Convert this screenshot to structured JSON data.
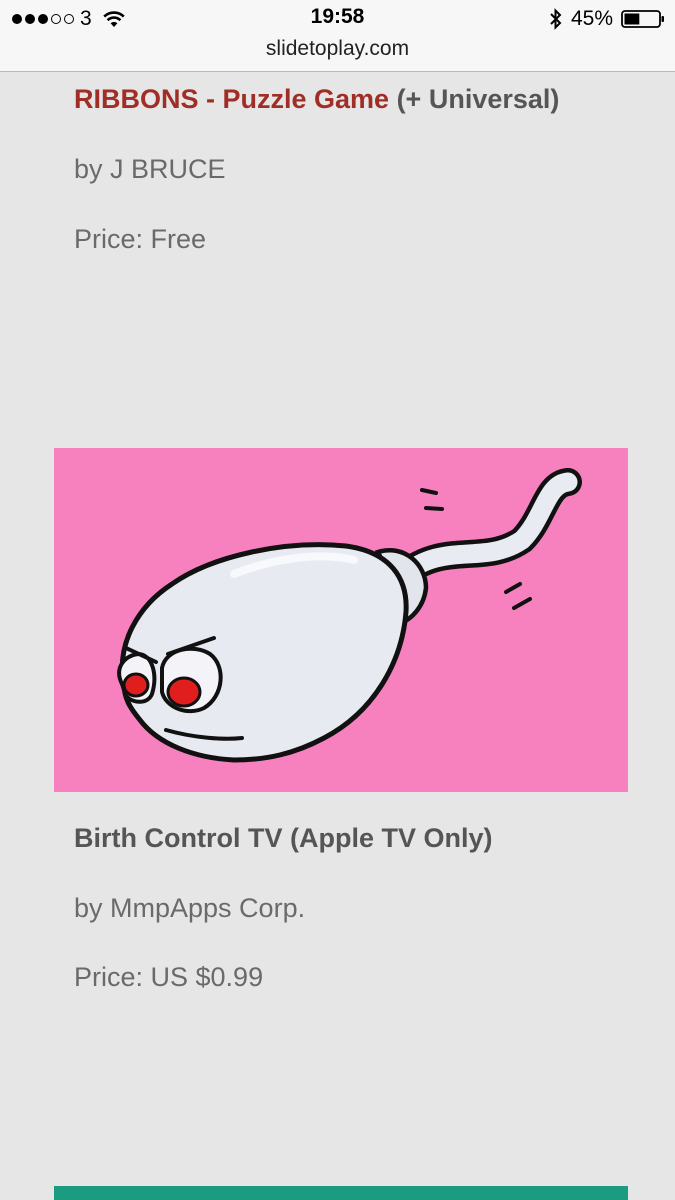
{
  "status_bar": {
    "carrier": "3",
    "signal_dots": [
      true,
      true,
      true,
      false,
      false
    ],
    "time": "19:58",
    "battery_percent": "45%",
    "battery_level": 0.45,
    "url": "slidetoplay.com"
  },
  "entries": [
    {
      "title_link": "RIBBONS - Puzzle Game",
      "title_suffix": " (+ Universal)",
      "author": "by J BRUCE",
      "price": "Price: Free"
    },
    {
      "title": "Birth Control TV (Apple TV Only)",
      "author": "by MmpApps Corp.",
      "price": "Price: US $0.99",
      "image_bg": "#f781be"
    }
  ],
  "colors": {
    "link": "#a12e26",
    "title": "#555555",
    "meta": "#6a6a6a",
    "page_bg": "#e6e6e6",
    "accent_bar": "#1b9c80"
  }
}
